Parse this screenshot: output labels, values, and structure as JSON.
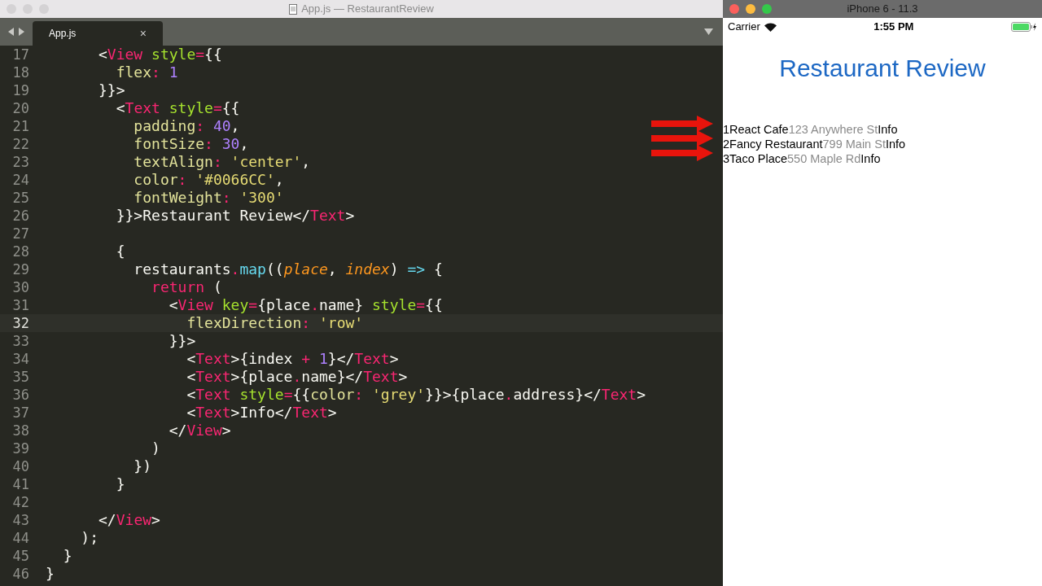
{
  "editor": {
    "window_title": "App.js — RestaurantReview",
    "tabs": [
      {
        "label": "App.js",
        "close": "×",
        "selected": true
      }
    ],
    "lines": [
      {
        "number": "17",
        "current": false,
        "tokens": [
          {
            "kind": "plain",
            "text": "      <"
          },
          {
            "kind": "tag",
            "text": "View"
          },
          {
            "kind": "attr",
            "text": " style"
          },
          {
            "kind": "op",
            "text": "="
          },
          {
            "kind": "plain",
            "text": "{{"
          }
        ]
      },
      {
        "number": "18",
        "current": false,
        "tokens": [
          {
            "kind": "key",
            "text": "        flex"
          },
          {
            "kind": "op",
            "text": ": "
          },
          {
            "kind": "num",
            "text": "1"
          }
        ]
      },
      {
        "number": "19",
        "current": false,
        "tokens": [
          {
            "kind": "plain",
            "text": "      }}>"
          }
        ]
      },
      {
        "number": "20",
        "current": false,
        "tokens": [
          {
            "kind": "plain",
            "text": "        <"
          },
          {
            "kind": "tag",
            "text": "Text"
          },
          {
            "kind": "attr",
            "text": " style"
          },
          {
            "kind": "op",
            "text": "="
          },
          {
            "kind": "plain",
            "text": "{{"
          }
        ]
      },
      {
        "number": "21",
        "current": false,
        "tokens": [
          {
            "kind": "key",
            "text": "          padding"
          },
          {
            "kind": "op",
            "text": ": "
          },
          {
            "kind": "num",
            "text": "40"
          },
          {
            "kind": "plain",
            "text": ","
          }
        ]
      },
      {
        "number": "22",
        "current": false,
        "tokens": [
          {
            "kind": "key",
            "text": "          fontSize"
          },
          {
            "kind": "op",
            "text": ": "
          },
          {
            "kind": "num",
            "text": "30"
          },
          {
            "kind": "plain",
            "text": ","
          }
        ]
      },
      {
        "number": "23",
        "current": false,
        "tokens": [
          {
            "kind": "key",
            "text": "          textAlign"
          },
          {
            "kind": "op",
            "text": ": "
          },
          {
            "kind": "str",
            "text": "'center'"
          },
          {
            "kind": "plain",
            "text": ","
          }
        ]
      },
      {
        "number": "24",
        "current": false,
        "tokens": [
          {
            "kind": "key",
            "text": "          color"
          },
          {
            "kind": "op",
            "text": ": "
          },
          {
            "kind": "str",
            "text": "'#0066CC'"
          },
          {
            "kind": "plain",
            "text": ","
          }
        ]
      },
      {
        "number": "25",
        "current": false,
        "tokens": [
          {
            "kind": "key",
            "text": "          fontWeight"
          },
          {
            "kind": "op",
            "text": ": "
          },
          {
            "kind": "str",
            "text": "'300'"
          }
        ]
      },
      {
        "number": "26",
        "current": false,
        "tokens": [
          {
            "kind": "plain",
            "text": "        }}>Restaurant Review</"
          },
          {
            "kind": "tag",
            "text": "Text"
          },
          {
            "kind": "plain",
            "text": ">"
          }
        ]
      },
      {
        "number": "27",
        "current": false
      },
      {
        "number": "28",
        "current": false,
        "tokens": [
          {
            "kind": "plain",
            "text": "        {"
          }
        ]
      },
      {
        "number": "29",
        "current": false,
        "tokens": [
          {
            "kind": "plain",
            "text": "          restaurants"
          },
          {
            "kind": "op",
            "text": "."
          },
          {
            "kind": "func",
            "text": "map"
          },
          {
            "kind": "plain",
            "text": "(("
          },
          {
            "kind": "param",
            "text": "place"
          },
          {
            "kind": "plain",
            "text": ", "
          },
          {
            "kind": "param",
            "text": "index"
          },
          {
            "kind": "plain",
            "text": ") "
          },
          {
            "kind": "func",
            "text": "=>"
          },
          {
            "kind": "plain",
            "text": " {"
          }
        ]
      },
      {
        "number": "30",
        "current": false,
        "tokens": [
          {
            "kind": "kw",
            "text": "            return"
          },
          {
            "kind": "plain",
            "text": " ("
          }
        ]
      },
      {
        "number": "31",
        "current": false,
        "tokens": [
          {
            "kind": "plain",
            "text": "              <"
          },
          {
            "kind": "tag",
            "text": "View"
          },
          {
            "kind": "attr",
            "text": " key"
          },
          {
            "kind": "op",
            "text": "="
          },
          {
            "kind": "plain",
            "text": "{place"
          },
          {
            "kind": "op",
            "text": "."
          },
          {
            "kind": "plain",
            "text": "name} "
          },
          {
            "kind": "attr",
            "text": "style"
          },
          {
            "kind": "op",
            "text": "="
          },
          {
            "kind": "plain",
            "text": "{{"
          }
        ]
      },
      {
        "number": "32",
        "current": true,
        "tokens": [
          {
            "kind": "key",
            "text": "                flexDirection"
          },
          {
            "kind": "op",
            "text": ": "
          },
          {
            "kind": "str",
            "text": "'row'"
          }
        ]
      },
      {
        "number": "33",
        "current": false,
        "tokens": [
          {
            "kind": "plain",
            "text": "              }}>"
          }
        ]
      },
      {
        "number": "34",
        "current": false,
        "tokens": [
          {
            "kind": "plain",
            "text": "                <"
          },
          {
            "kind": "tag",
            "text": "Text"
          },
          {
            "kind": "plain",
            "text": ">{index "
          },
          {
            "kind": "op",
            "text": "+"
          },
          {
            "kind": "num",
            "text": " 1"
          },
          {
            "kind": "plain",
            "text": "}</"
          },
          {
            "kind": "tag",
            "text": "Text"
          },
          {
            "kind": "plain",
            "text": ">"
          }
        ]
      },
      {
        "number": "35",
        "current": false,
        "tokens": [
          {
            "kind": "plain",
            "text": "                <"
          },
          {
            "kind": "tag",
            "text": "Text"
          },
          {
            "kind": "plain",
            "text": ">{place"
          },
          {
            "kind": "op",
            "text": "."
          },
          {
            "kind": "plain",
            "text": "name}</"
          },
          {
            "kind": "tag",
            "text": "Text"
          },
          {
            "kind": "plain",
            "text": ">"
          }
        ]
      },
      {
        "number": "36",
        "current": false,
        "tokens": [
          {
            "kind": "plain",
            "text": "                <"
          },
          {
            "kind": "tag",
            "text": "Text"
          },
          {
            "kind": "attr",
            "text": " style"
          },
          {
            "kind": "op",
            "text": "="
          },
          {
            "kind": "plain",
            "text": "{{"
          },
          {
            "kind": "key",
            "text": "color"
          },
          {
            "kind": "op",
            "text": ": "
          },
          {
            "kind": "str",
            "text": "'grey'"
          },
          {
            "kind": "plain",
            "text": "}}>{place"
          },
          {
            "kind": "op",
            "text": "."
          },
          {
            "kind": "plain",
            "text": "address}</"
          },
          {
            "kind": "tag",
            "text": "Text"
          },
          {
            "kind": "plain",
            "text": ">"
          }
        ]
      },
      {
        "number": "37",
        "current": false,
        "tokens": [
          {
            "kind": "plain",
            "text": "                <"
          },
          {
            "kind": "tag",
            "text": "Text"
          },
          {
            "kind": "plain",
            "text": ">Info</"
          },
          {
            "kind": "tag",
            "text": "Text"
          },
          {
            "kind": "plain",
            "text": ">"
          }
        ]
      },
      {
        "number": "38",
        "current": false,
        "tokens": [
          {
            "kind": "plain",
            "text": "              </"
          },
          {
            "kind": "tag",
            "text": "View"
          },
          {
            "kind": "plain",
            "text": ">"
          }
        ]
      },
      {
        "number": "39",
        "current": false,
        "tokens": [
          {
            "kind": "plain",
            "text": "            )"
          }
        ]
      },
      {
        "number": "40",
        "current": false,
        "tokens": [
          {
            "kind": "plain",
            "text": "          })"
          }
        ]
      },
      {
        "number": "41",
        "current": false,
        "tokens": [
          {
            "kind": "plain",
            "text": "        }"
          }
        ]
      },
      {
        "number": "42",
        "current": false
      },
      {
        "number": "43",
        "current": false,
        "tokens": [
          {
            "kind": "plain",
            "text": "      </"
          },
          {
            "kind": "tag",
            "text": "View"
          },
          {
            "kind": "plain",
            "text": ">"
          }
        ]
      },
      {
        "number": "44",
        "current": false,
        "tokens": [
          {
            "kind": "plain",
            "text": "    );"
          }
        ]
      },
      {
        "number": "45",
        "current": false,
        "tokens": [
          {
            "kind": "plain",
            "text": "  }"
          }
        ]
      },
      {
        "number": "46",
        "current": false,
        "tokens": [
          {
            "kind": "plain",
            "text": "}"
          }
        ]
      }
    ]
  },
  "simulator": {
    "window_title": "iPhone 6 - 11.3",
    "status_bar": {
      "carrier": "Carrier",
      "time": "1:55 PM"
    },
    "heading": "Restaurant Review",
    "restaurants": [
      {
        "index": "1",
        "name": "React Cafe",
        "address": "123 Anywhere St",
        "action": "Info"
      },
      {
        "index": "2",
        "name": "Fancy Restaurant",
        "address": "799 Main St",
        "action": "Info"
      },
      {
        "index": "3",
        "name": "Taco Place",
        "address": "550 Maple Rd",
        "action": "Info"
      }
    ]
  }
}
